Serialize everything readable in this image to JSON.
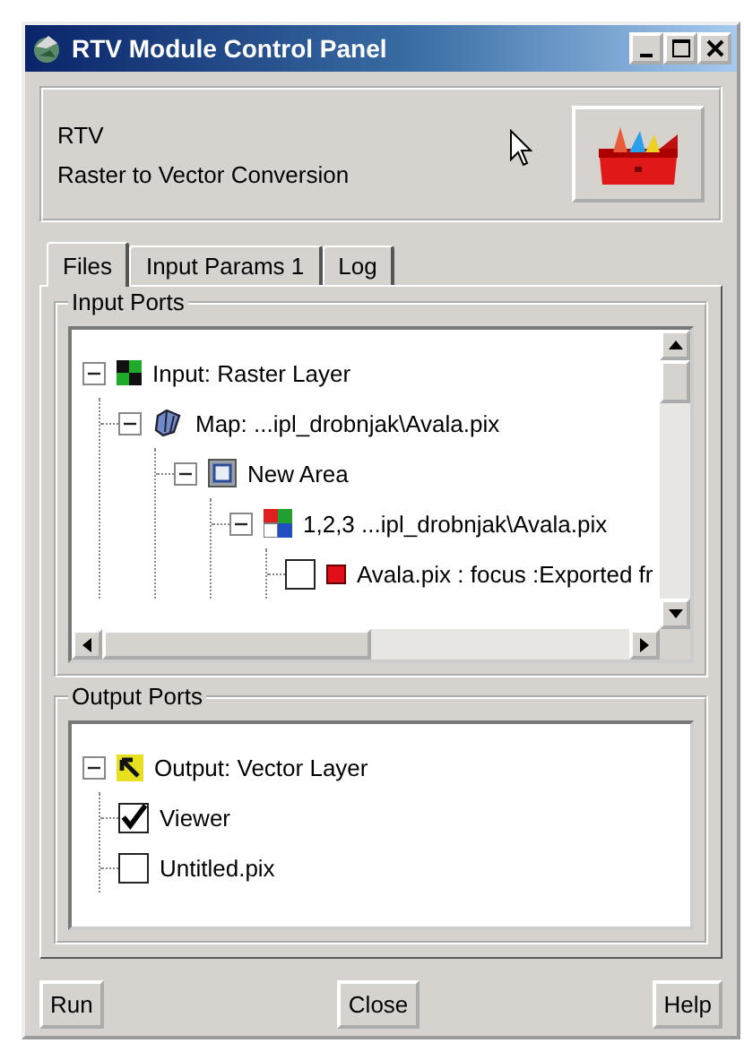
{
  "window": {
    "title": "RTV Module Control Panel"
  },
  "header": {
    "title": "RTV",
    "subtitle": "Raster to Vector Conversion"
  },
  "tabs": [
    {
      "label": "Files",
      "selected": true
    },
    {
      "label": "Input Params 1",
      "selected": false
    },
    {
      "label": "Log",
      "selected": false
    }
  ],
  "input_ports": {
    "title": "Input Ports",
    "tree": [
      {
        "label": "Input: Raster Layer",
        "kind": "raster",
        "expanded": true,
        "children": [
          {
            "label": "Map: ...ipl_drobnjak\\Avala.pix",
            "kind": "map",
            "expanded": true,
            "children": [
              {
                "label": "New Area",
                "kind": "area",
                "expanded": true,
                "children": [
                  {
                    "label": "1,2,3 ...ipl_drobnjak\\Avala.pix",
                    "kind": "rgb",
                    "expanded": true,
                    "children": [
                      {
                        "label": "Avala.pix : focus  :Exported fr",
                        "kind": "band",
                        "checked": false
                      }
                    ]
                  }
                ]
              }
            ]
          }
        ]
      }
    ]
  },
  "output_ports": {
    "title": "Output Ports",
    "tree": [
      {
        "label": "Output: Vector Layer",
        "kind": "vector",
        "expanded": true,
        "children": [
          {
            "label": "Viewer",
            "checked": true
          },
          {
            "label": "Untitled.pix",
            "checked": false
          }
        ]
      }
    ]
  },
  "buttons": [
    "Run",
    "Close",
    "Help"
  ]
}
